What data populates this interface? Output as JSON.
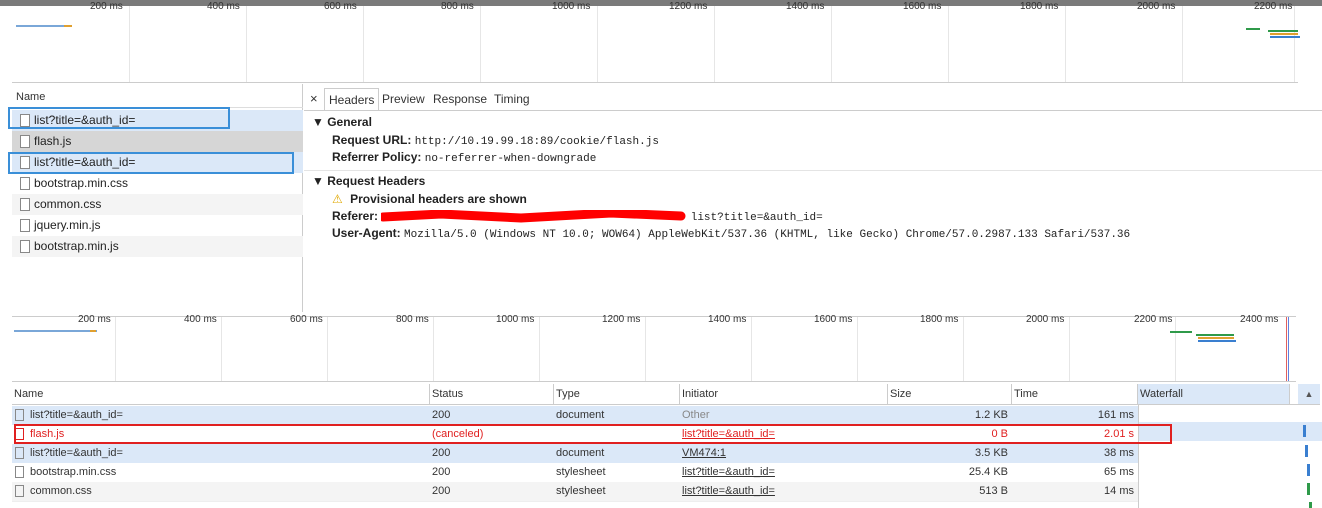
{
  "top_overview": {
    "ticks": [
      "200 ms",
      "400 ms",
      "600 ms",
      "800 ms",
      "1000 ms",
      "1200 ms",
      "1400 ms",
      "1600 ms",
      "1800 ms",
      "2000 ms",
      "2200 ms"
    ]
  },
  "upper_list": {
    "header": "Name",
    "items": [
      {
        "label": "list?title=&auth_id="
      },
      {
        "label": "flash.js"
      },
      {
        "label": "list?title=&auth_id="
      },
      {
        "label": "bootstrap.min.css"
      },
      {
        "label": "common.css"
      },
      {
        "label": "jquery.min.js"
      },
      {
        "label": "bootstrap.min.js"
      }
    ]
  },
  "detail": {
    "close": "×",
    "tabs": [
      {
        "label": "Headers"
      },
      {
        "label": "Preview"
      },
      {
        "label": "Response"
      },
      {
        "label": "Timing"
      }
    ],
    "general": {
      "title": "▼ General",
      "request_url_key": "Request URL:",
      "request_url_value": "http://10.19.99.18:89/cookie/flash.js",
      "referrer_policy_key": "Referrer Policy:",
      "referrer_policy_value": "no-referrer-when-downgrade"
    },
    "request_headers": {
      "title": "▼ Request Headers",
      "warning": "Provisional headers are shown",
      "referer_key": "Referer:",
      "referer_value_visible": "list?title=&auth_id=",
      "user_agent_key": "User-Agent:",
      "user_agent_value": "Mozilla/5.0 (Windows NT 10.0; WOW64) AppleWebKit/537.36 (KHTML, like Gecko) Chrome/57.0.2987.133 Safari/537.36"
    }
  },
  "lower_overview": {
    "ticks": [
      "200 ms",
      "400 ms",
      "600 ms",
      "800 ms",
      "1000 ms",
      "1200 ms",
      "1400 ms",
      "1600 ms",
      "1800 ms",
      "2000 ms",
      "2200 ms",
      "2400 ms"
    ]
  },
  "table": {
    "headers": [
      "Name",
      "Status",
      "Type",
      "Initiator",
      "Size",
      "Time",
      "Waterfall"
    ],
    "rows": [
      {
        "name": "list?title=&auth_id=",
        "status": "200",
        "type": "document",
        "initiator": "Other",
        "size": "1.2 KB",
        "time": "161 ms"
      },
      {
        "name": "flash.js",
        "status": "(canceled)",
        "type": "",
        "initiator": "list?title=&auth_id=",
        "size": "0 B",
        "time": "2.01 s"
      },
      {
        "name": "list?title=&auth_id=",
        "status": "200",
        "type": "document",
        "initiator": "VM474:1",
        "size": "3.5 KB",
        "time": "38 ms"
      },
      {
        "name": "bootstrap.min.css",
        "status": "200",
        "type": "stylesheet",
        "initiator": "list?title=&auth_id=",
        "size": "25.4 KB",
        "time": "65 ms"
      },
      {
        "name": "common.css",
        "status": "200",
        "type": "stylesheet",
        "initiator": "list?title=&auth_id=",
        "size": "513 B",
        "time": "14 ms"
      }
    ]
  },
  "colors": {
    "highlight_blue": "#3a8fd8",
    "annotation_red": "#e02020",
    "selected_row": "#dbe8f8",
    "redaction_red": "#ff0000"
  }
}
